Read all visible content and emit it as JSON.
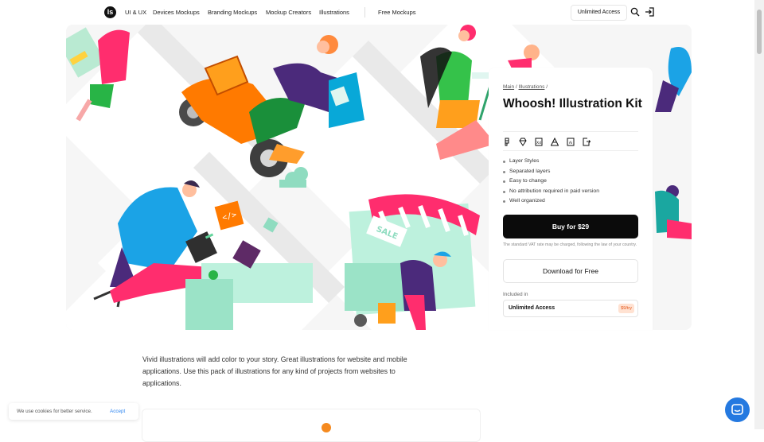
{
  "nav": {
    "logo": "ls",
    "links": [
      "UI & UX",
      "Devices Mockups",
      "Branding Mockups",
      "Mockup Creators",
      "Illustrations",
      "Free Mockups"
    ],
    "unlimited_access": "Unlimited Access"
  },
  "hero": {
    "sale_sign": "SALE"
  },
  "product": {
    "breadcrumb": [
      "Main",
      "Illustrations"
    ],
    "title": "Whoosh! Illustration Kit",
    "formats": [
      "figma-icon",
      "sketch-icon",
      "xd-icon",
      "affinity-icon",
      "illustrator-icon",
      "export-icon"
    ],
    "features": [
      "Layer Styles",
      "Separated layers",
      "Easy to change",
      "No attribution required in paid version",
      "Well organized"
    ],
    "buy_label": "Buy for $29",
    "vat_note": "The standard VAT rate may be charged, following the law of your country.",
    "download_label": "Download for Free",
    "included_label": "Included in",
    "included_item": "Unlimited Access",
    "included_price": "$9/try"
  },
  "description": "Vivid illustrations will add color to your story. Great illustrations for website and mobile applications. Use this pack of illustrations for any kind of projects from websites to applications.",
  "cookie": {
    "text": "We use cookies for better service.",
    "accept": "Accept"
  },
  "colors": {
    "accent": "#0b0b0b",
    "badge_bg": "#ffe2d2",
    "badge_text": "#e4571b",
    "chat": "#2479e0",
    "link_blue": "#2f86f0"
  }
}
